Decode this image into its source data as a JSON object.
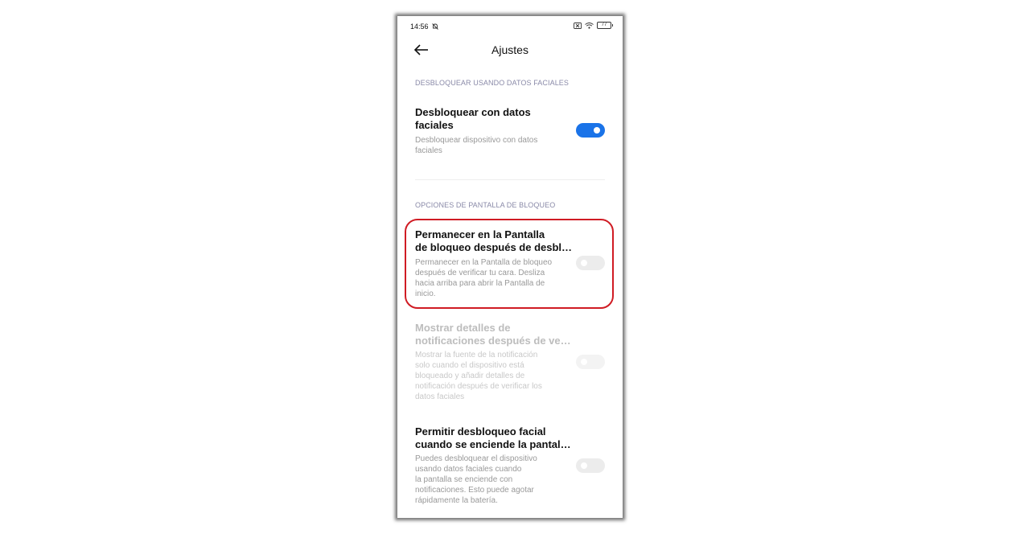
{
  "status_bar": {
    "time": "14:56",
    "battery": "77"
  },
  "header": {
    "title": "Ajustes"
  },
  "sections": [
    {
      "label": "DESBLOQUEAR USANDO DATOS FACIALES",
      "items": [
        {
          "title": "Desbloquear con datos\nfaciales",
          "description": "Desbloquear dispositivo con datos\nfaciales",
          "toggle": "on",
          "enabled": true
        }
      ]
    },
    {
      "label": "OPCIONES DE PANTALLA DE BLOQUEO",
      "items": [
        {
          "title": "Permanecer en la Pantalla\nde bloqueo después de desbl…",
          "description": "Permanecer en la Pantalla de bloqueo\ndespués de verificar tu cara. Desliza\nhacia arriba para abrir la Pantalla de\ninicio.",
          "toggle": "off",
          "enabled": true
        },
        {
          "title": "Mostrar detalles de\nnotificaciones después de ve…",
          "description": "Mostrar la fuente de la notificación\nsolo cuando el dispositivo está\nbloqueado y añadir detalles de\nnotificación después de verificar los\ndatos faciales",
          "toggle": "off",
          "enabled": false
        },
        {
          "title": "Permitir desbloqueo facial\ncuando se enciende la pantal…",
          "description": "Puedes desbloquear el dispositivo\nusando datos faciales cuando\nla pantalla se enciende con\nnotificaciones. Esto puede agotar\nrápidamente la batería.",
          "toggle": "off",
          "enabled": true
        }
      ]
    }
  ],
  "colors": {
    "accent": "#1a73e8",
    "highlight": "#d01c24"
  }
}
